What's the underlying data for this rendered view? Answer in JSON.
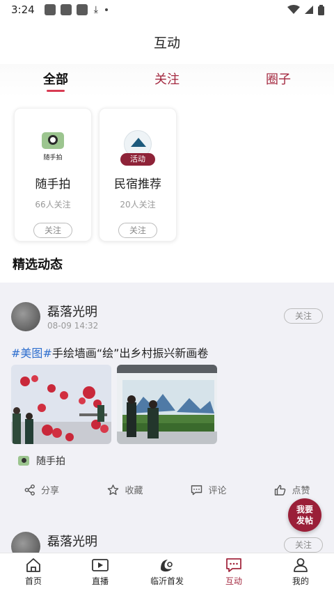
{
  "status_bar": {
    "time": "3:24",
    "download_glyph": "⤓",
    "dot": "•"
  },
  "header": {
    "title": "互动"
  },
  "tabs": [
    {
      "label": "全部",
      "active": true
    },
    {
      "label": "关注",
      "active": false
    },
    {
      "label": "圈子",
      "active": false
    }
  ],
  "circles": [
    {
      "name": "随手拍",
      "count": "66人关注",
      "follow": "关注",
      "icon_caption": "随手拍",
      "icon": "camera-icon"
    },
    {
      "name": "民宿推荐",
      "count": "20人关注",
      "follow": "关注",
      "badge": "活动",
      "icon": "minsu-logo"
    }
  ],
  "section": {
    "title": "精选动态"
  },
  "post": {
    "author": "磊落光明",
    "time": "08-09 14:32",
    "follow": "关注",
    "tag": "#美图#",
    "text": "手绘墙画“绘”出乡村振兴新画卷",
    "circle": "随手拍",
    "actions": {
      "share": "分享",
      "collect": "收藏",
      "comment": "评论",
      "like": "点赞"
    }
  },
  "post2": {
    "author": "磊落光明",
    "follow": "关注"
  },
  "fab": {
    "line1": "我要",
    "line2": "发帖"
  },
  "bottom_nav": [
    {
      "label": "首页",
      "icon": "home-icon"
    },
    {
      "label": "直播",
      "icon": "live-icon"
    },
    {
      "label": "临沂首发",
      "icon": "linyi-logo-icon"
    },
    {
      "label": "互动",
      "icon": "chat-icon",
      "active": true
    },
    {
      "label": "我的",
      "icon": "user-icon"
    }
  ],
  "colors": {
    "accent": "#a3283f",
    "tab_indicator": "#d83b52",
    "tag_blue": "#2f6fce",
    "fab": "#9a1f38"
  }
}
